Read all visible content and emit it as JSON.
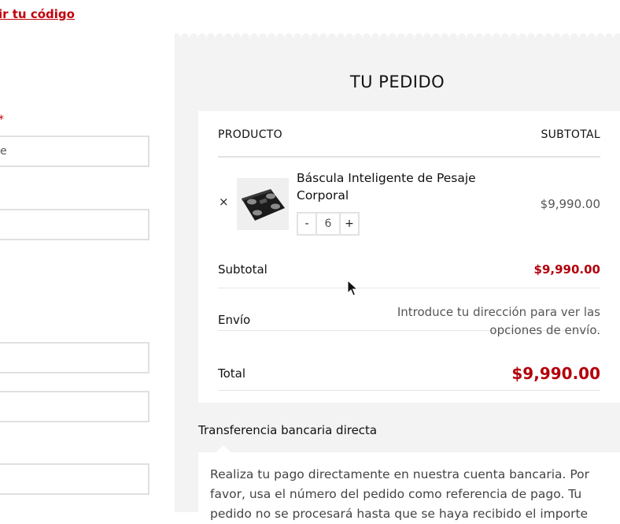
{
  "coupon": {
    "link_text": "ir tu código"
  },
  "billing_form": {
    "required_mark": "*",
    "first_field_value": "e"
  },
  "order": {
    "title": "TU PEDIDO",
    "headers": {
      "product": "PRODUCTO",
      "subtotal": "SUBTOTAL"
    },
    "item": {
      "remove_icon": "×",
      "name": "Báscula Inteligente de Pesaje Corporal",
      "qty_minus": "-",
      "qty_value": "6",
      "qty_plus": "+",
      "price": "$9,990.00"
    },
    "subtotal_label": "Subtotal",
    "subtotal_value": "$9,990.00",
    "shipping_label": "Envío",
    "shipping_note": "Introduce tu dirección para ver las opciones de envío.",
    "total_label": "Total",
    "total_value": "$9,990.00"
  },
  "payment": {
    "method_label": "Transferencia bancaria directa",
    "description": "Realiza tu pago directamente en nuestra cuenta bancaria. Por favor, usa el número del pedido como referencia de pago. Tu pedido no se procesará hasta que se haya recibido el importe"
  },
  "colors": {
    "accent": "#b3000b",
    "panel_bg": "#f3f3f3"
  },
  "icons": {
    "product_image": "smart-scale-image",
    "cursor": "mouse-pointer-icon"
  }
}
